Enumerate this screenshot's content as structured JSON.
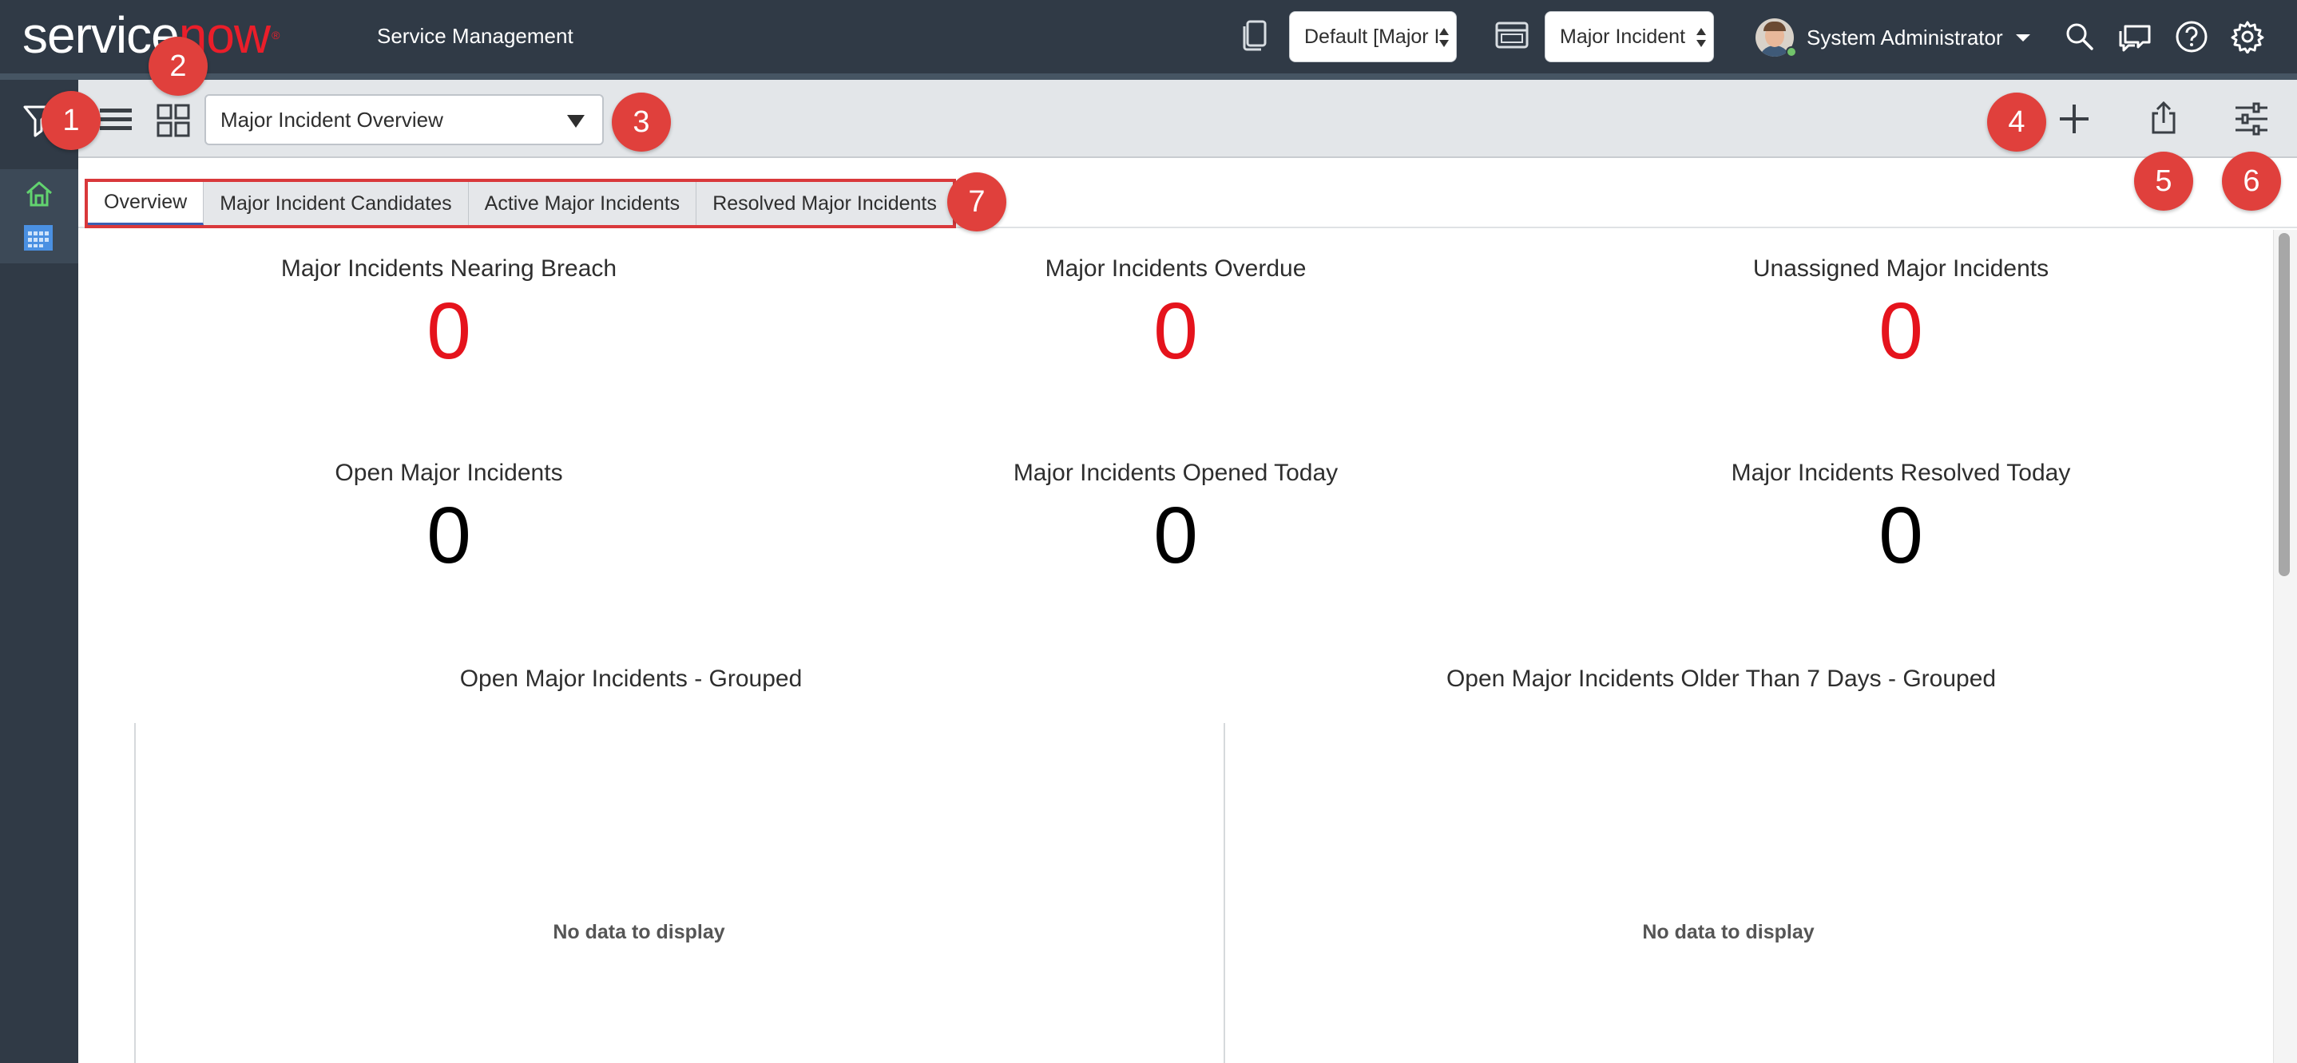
{
  "header": {
    "logo_white": "service",
    "logo_green": "now",
    "logo_tm": "®",
    "app_title": "Service Management",
    "dashboard_selector": "Default [Major I",
    "role_selector": "Major Incident",
    "user_name": "System Administrator"
  },
  "toolbar": {
    "dashboard_title": "Major Incident Overview"
  },
  "tabs": [
    {
      "label": "Overview"
    },
    {
      "label": "Major Incident Candidates"
    },
    {
      "label": "Active Major Incidents"
    },
    {
      "label": "Resolved Major Incidents"
    }
  ],
  "badges": [
    "1",
    "2",
    "3",
    "4",
    "5",
    "6",
    "7"
  ],
  "stats": [
    {
      "label": "Major Incidents Nearing Breach",
      "value": "0"
    },
    {
      "label": "Major Incidents Overdue",
      "value": "0"
    },
    {
      "label": "Unassigned Major Incidents",
      "value": "0"
    },
    {
      "label": "Open Major Incidents",
      "value": "0"
    },
    {
      "label": "Major Incidents Opened Today",
      "value": "0"
    },
    {
      "label": "Major Incidents Resolved Today",
      "value": "0"
    }
  ],
  "charts": [
    {
      "title": "Open Major Incidents - Grouped",
      "empty_text": "No data to display"
    },
    {
      "title": "Open Major Incidents Older Than 7 Days - Grouped",
      "empty_text": "No data to display"
    }
  ],
  "colors": {
    "header_bg": "#303a46",
    "brand_green": "#ea1e2a",
    "alert_red": "#e5131c",
    "badge_red": "#e0403c"
  }
}
